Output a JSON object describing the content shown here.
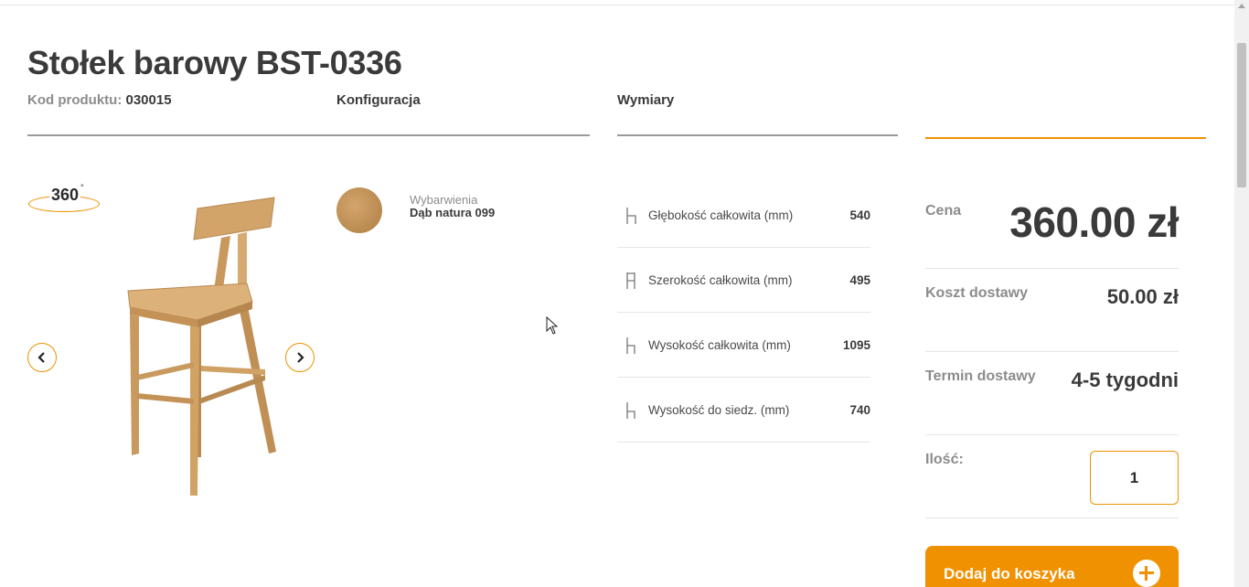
{
  "product": {
    "title": "Stołek barowy BST-0336",
    "code_label": "Kod produktu:",
    "code_value": "030015"
  },
  "sections": {
    "configuration": "Konfiguracja",
    "dimensions": "Wymiary"
  },
  "viewer": {
    "badge": "360",
    "badge_degree": "°",
    "prev_icon": "chevron-left-icon",
    "next_icon": "chevron-right-icon"
  },
  "configuration": {
    "label": "Wybarwienia",
    "value": "Dąb natura 099",
    "swatch_color": "#c19458"
  },
  "dimensions": [
    {
      "label": "Głębokość całkowita (mm)",
      "value": "540",
      "icon": "depth-icon"
    },
    {
      "label": "Szerokość całkowita (mm)",
      "value": "495",
      "icon": "width-icon"
    },
    {
      "label": "Wysokość całkowita (mm)",
      "value": "1095",
      "icon": "height-icon"
    },
    {
      "label": "Wysokość do siedz. (mm)",
      "value": "740",
      "icon": "seat-height-icon"
    }
  ],
  "pricing": {
    "price_label": "Cena",
    "price_value": "360.00 zł",
    "delivery_cost_label": "Koszt dostawy",
    "delivery_cost_value": "50.00 zł",
    "delivery_time_label": "Termin dostawy",
    "delivery_time_value": "4-5 tygodni",
    "quantity_label": "Ilość:",
    "quantity_value": "1"
  },
  "cart": {
    "add_label": "Dodaj do koszyka"
  },
  "colors": {
    "accent": "#ef9100",
    "text": "#3a3a3a",
    "muted": "#8c8c8c"
  }
}
